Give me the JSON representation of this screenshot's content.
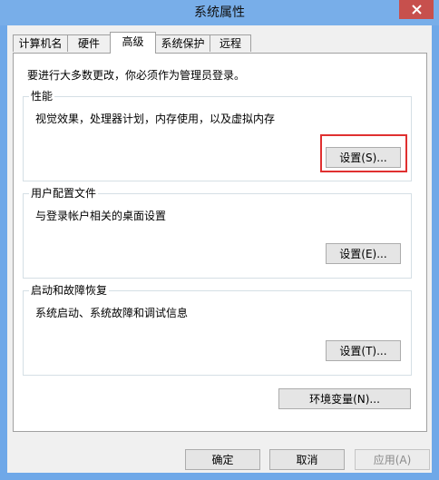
{
  "window": {
    "title": "系统属性"
  },
  "tabs": [
    {
      "label": "计算机名",
      "active": false
    },
    {
      "label": "硬件",
      "active": false
    },
    {
      "label": "高级",
      "active": true
    },
    {
      "label": "系统保护",
      "active": false
    },
    {
      "label": "远程",
      "active": false
    }
  ],
  "panel": {
    "admin_notice": "要进行大多数更改，你必须作为管理员登录。",
    "performance": {
      "title": "性能",
      "description": "视觉效果，处理器计划，内存使用，以及虚拟内存",
      "button": "设置(S)..."
    },
    "user_profiles": {
      "title": "用户配置文件",
      "description": "与登录帐户相关的桌面设置",
      "button": "设置(E)..."
    },
    "startup_recovery": {
      "title": "启动和故障恢复",
      "description": "系统启动、系统故障和调试信息",
      "button": "设置(T)..."
    },
    "env_vars_button": "环境变量(N)..."
  },
  "footer": {
    "ok": "确定",
    "cancel": "取消",
    "apply": "应用(A)"
  },
  "highlight_color": "#e03030"
}
